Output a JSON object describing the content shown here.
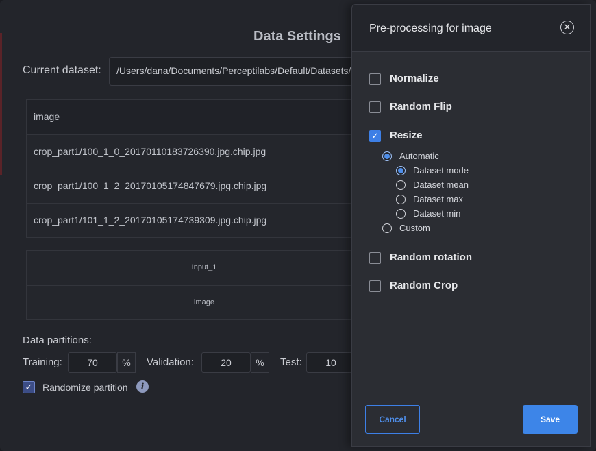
{
  "dialog": {
    "title": "Data Settings",
    "current_dataset_label": "Current dataset:",
    "current_dataset_path": "/Users/dana/Documents/Perceptilabs/Default/Datasets/"
  },
  "table": {
    "header": "image",
    "rows": [
      "crop_part1/100_1_0_20170110183726390.jpg.chip.jpg",
      "crop_part1/100_1_2_20170105174847679.jpg.chip.jpg",
      "crop_part1/101_1_2_20170105174739309.jpg.chip.jpg"
    ]
  },
  "mapping": {
    "input": "Input_1",
    "type": "image"
  },
  "partitions": {
    "label": "Data partitions:",
    "training_label": "Training:",
    "training_value": "70",
    "validation_label": "Validation:",
    "validation_value": "20",
    "test_label": "Test:",
    "test_value": "10",
    "percent": "%",
    "randomize_label": "Randomize partition",
    "randomize_checked": true
  },
  "panel": {
    "title": "Pre-processing for image",
    "options": {
      "normalize": {
        "label": "Normalize",
        "checked": false
      },
      "random_flip": {
        "label": "Random Flip",
        "checked": false
      },
      "resize": {
        "label": "Resize",
        "checked": true
      },
      "random_rotation": {
        "label": "Random rotation",
        "checked": false
      },
      "random_crop": {
        "label": "Random Crop",
        "checked": false
      }
    },
    "resize_mode": {
      "automatic": "Automatic",
      "custom": "Custom",
      "selected": "Automatic"
    },
    "auto_options": {
      "mode": "Dataset mode",
      "mean": "Dataset mean",
      "max": "Dataset max",
      "min": "Dataset min",
      "selected": "Dataset mode"
    },
    "cancel_label": "Cancel",
    "save_label": "Save"
  },
  "colors": {
    "accent": "#3d85e8",
    "panel_bg": "#2b2d33",
    "background": "#23252b"
  }
}
